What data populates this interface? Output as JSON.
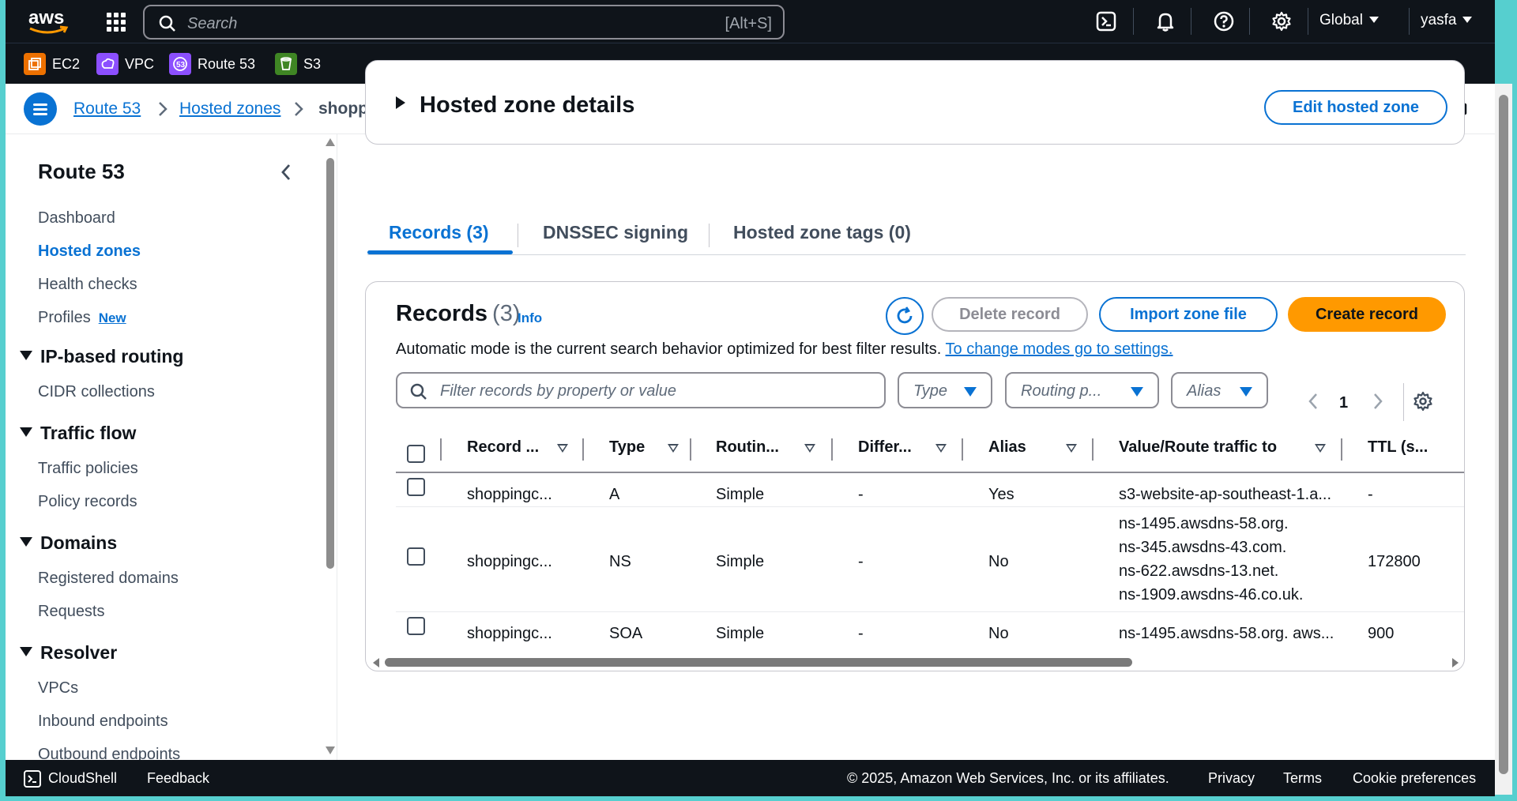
{
  "topbar": {
    "logo_text": "aws",
    "search_placeholder": "Search",
    "search_shortcut": "[Alt+S]",
    "region": "Global",
    "user": "yasfa",
    "icons": [
      "cloudshell-icon",
      "bell-icon",
      "help-icon",
      "settings-icon"
    ]
  },
  "services": [
    {
      "label": "EC2",
      "color": "#ed7100"
    },
    {
      "label": "VPC",
      "color": "#8c4fff"
    },
    {
      "label": "Route 53",
      "color": "#8c4fff"
    },
    {
      "label": "S3",
      "color": "#3f8624"
    }
  ],
  "breadcrumb": {
    "items": [
      "Route 53",
      "Hosted zones"
    ],
    "current": "shoppingcarts.life"
  },
  "sidebar": {
    "title": "Route 53",
    "items": [
      "Dashboard",
      "Hosted zones",
      "Health checks",
      "Profiles"
    ],
    "profiles_badge": "New",
    "sections": [
      {
        "title": "IP-based routing",
        "items": [
          "CIDR collections"
        ]
      },
      {
        "title": "Traffic flow",
        "items": [
          "Traffic policies",
          "Policy records"
        ]
      },
      {
        "title": "Domains",
        "items": [
          "Registered domains",
          "Requests"
        ]
      },
      {
        "title": "Resolver",
        "items": [
          "VPCs",
          "Inbound endpoints",
          "Outbound endpoints"
        ]
      }
    ]
  },
  "details": {
    "title": "Hosted zone details",
    "edit_button": "Edit hosted zone"
  },
  "tabs": [
    "Records (3)",
    "DNSSEC signing",
    "Hosted zone tags (0)"
  ],
  "records": {
    "title": "Records",
    "count": "(3)",
    "info": "Info",
    "delete_button": "Delete record",
    "import_button": "Import zone file",
    "create_button": "Create record",
    "mode_text": "Automatic mode is the current search behavior optimized for best filter results.",
    "mode_link": "To change modes go to settings.",
    "filter_placeholder": "Filter records by property or value",
    "filters": [
      "Type",
      "Routing p...",
      "Alias"
    ],
    "page": "1",
    "columns": [
      "Record ...",
      "Type",
      "Routin...",
      "Differ...",
      "Alias",
      "Value/Route traffic to",
      "TTL (s..."
    ],
    "rows": [
      {
        "name": "shoppingc...",
        "type": "A",
        "routing": "Simple",
        "differ": "-",
        "alias": "Yes",
        "value": [
          "s3-website-ap-southeast-1.a..."
        ],
        "ttl": "-"
      },
      {
        "name": "shoppingc...",
        "type": "NS",
        "routing": "Simple",
        "differ": "-",
        "alias": "No",
        "value": [
          "ns-1495.awsdns-58.org.",
          "ns-345.awsdns-43.com.",
          "ns-622.awsdns-13.net.",
          "ns-1909.awsdns-46.co.uk."
        ],
        "ttl": "172800"
      },
      {
        "name": "shoppingc...",
        "type": "SOA",
        "routing": "Simple",
        "differ": "-",
        "alias": "No",
        "value": [
          "ns-1495.awsdns-58.org. aws..."
        ],
        "ttl": "900"
      }
    ]
  },
  "footer": {
    "cloudshell": "CloudShell",
    "feedback": "Feedback",
    "copyright": "© 2025, Amazon Web Services, Inc. or its affiliates.",
    "links": [
      "Privacy",
      "Terms",
      "Cookie preferences"
    ]
  }
}
